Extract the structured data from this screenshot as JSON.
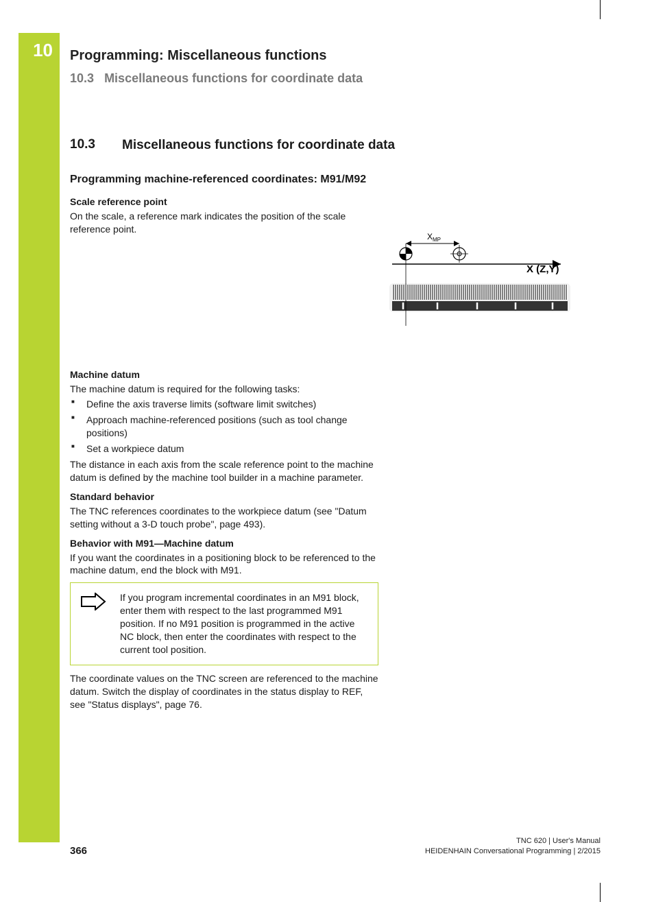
{
  "chapter": {
    "num": "10",
    "title": "Programming: Miscellaneous functions"
  },
  "breadcrumb": {
    "num": "10.3",
    "title": "Miscellaneous functions for coordinate data"
  },
  "section": {
    "num": "10.3",
    "title": "Miscellaneous functions for coordinate data"
  },
  "h_a": "Programming machine-referenced coordinates: M91/M92",
  "scale_ref": {
    "heading": "Scale reference point",
    "text": "On the scale, a reference mark indicates the position of the scale reference point."
  },
  "diagram": {
    "xmp": "X",
    "xmp_sub": "MP",
    "axis": "X (Z,Y)"
  },
  "machine_datum": {
    "heading": "Machine datum",
    "intro": "The machine datum is required for the following tasks:",
    "bullets": [
      "Define the axis traverse limits (software limit switches)",
      "Approach machine-referenced positions (such as tool change positions)",
      "Set a workpiece datum"
    ],
    "after": "The distance in each axis from the scale reference point to the machine datum is defined by the machine tool builder in a machine parameter."
  },
  "standard": {
    "heading": "Standard behavior",
    "text": "The TNC references coordinates to the workpiece datum (see \"Datum setting without a 3-D touch probe\", page 493)."
  },
  "m91": {
    "heading": "Behavior with M91—Machine datum",
    "text": "If you want the coordinates in a positioning block to be referenced to the machine datum, end the block with M91.",
    "note": "If you program incremental coordinates in an M91 block, enter them with respect to the last programmed M91 position. If no M91 position is programmed in the active NC block, then enter the coordinates with respect to the current tool position.",
    "after": "The coordinate values on the TNC screen are referenced to the machine datum. Switch the display of coordinates in the status display to REF, see \"Status displays\", page 76."
  },
  "footer": {
    "page": "366",
    "line1": "TNC 620 | User's Manual",
    "line2": "HEIDENHAIN Conversational Programming | 2/2015"
  }
}
